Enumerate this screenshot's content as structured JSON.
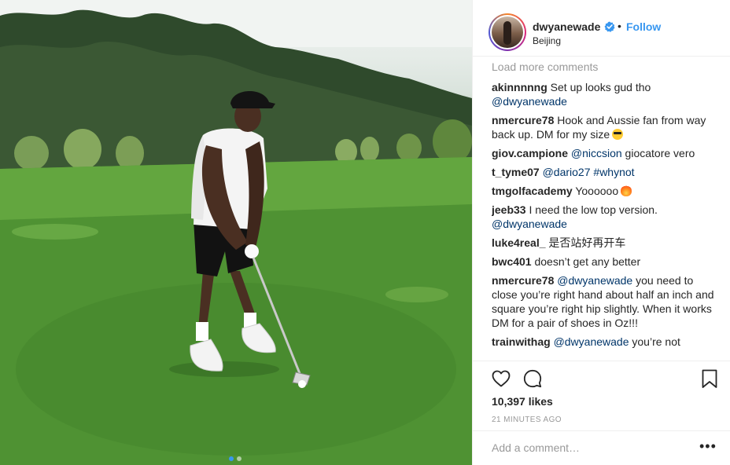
{
  "post": {
    "username": "dwyanewade",
    "bullet": "•",
    "follow_label": "Follow",
    "location": "Beijing",
    "load_more": "Load more comments",
    "likes": "10,397 likes",
    "timestamp": "21 MINUTES AGO",
    "add_comment_placeholder": "Add a comment…",
    "more_label": "•••",
    "carousel_count": 2,
    "carousel_active_index": 0
  },
  "comments": [
    {
      "user": "akinnnnng",
      "parts": [
        {
          "t": "text",
          "v": " Set up looks gud tho "
        },
        {
          "t": "mention",
          "v": "@dwyanewade"
        }
      ]
    },
    {
      "user": "nmercure78",
      "parts": [
        {
          "t": "text",
          "v": " Hook and Aussie fan from way back up. DM for my size"
        },
        {
          "t": "emoji",
          "v": "cool"
        }
      ]
    },
    {
      "user": "giov.campione",
      "parts": [
        {
          "t": "text",
          "v": " "
        },
        {
          "t": "mention",
          "v": "@niccsion"
        },
        {
          "t": "text",
          "v": " giocatore vero"
        }
      ]
    },
    {
      "user": "t_tyme07",
      "parts": [
        {
          "t": "text",
          "v": " "
        },
        {
          "t": "mention",
          "v": "@dario27"
        },
        {
          "t": "text",
          "v": " "
        },
        {
          "t": "mention",
          "v": "#whynot"
        }
      ]
    },
    {
      "user": "tmgolfacademy",
      "parts": [
        {
          "t": "text",
          "v": " Yoooooo"
        },
        {
          "t": "emoji",
          "v": "fire"
        }
      ]
    },
    {
      "user": "jeeb33",
      "parts": [
        {
          "t": "text",
          "v": " I need the low top version. "
        },
        {
          "t": "mention",
          "v": "@dwyanewade"
        }
      ]
    },
    {
      "user": "luke4real_",
      "parts": [
        {
          "t": "text",
          "v": " 是否站好再开车"
        }
      ]
    },
    {
      "user": "bwc401",
      "parts": [
        {
          "t": "text",
          "v": " doesn’t get any better"
        }
      ]
    },
    {
      "user": "nmercure78",
      "parts": [
        {
          "t": "text",
          "v": " "
        },
        {
          "t": "mention",
          "v": "@dwyanewade"
        },
        {
          "t": "text",
          "v": " you need to close you’re right hand about half an inch and square you’re right hip slightly. When it works DM for a pair of shoes in Oz!!!"
        }
      ]
    },
    {
      "user": "trainwithag",
      "parts": [
        {
          "t": "text",
          "v": " "
        },
        {
          "t": "mention",
          "v": "@dwyanewade"
        },
        {
          "t": "text",
          "v": " you’re not"
        }
      ]
    }
  ],
  "colors": {
    "link": "#3897f0",
    "mention": "#003569",
    "muted": "#999999",
    "border": "#efefef"
  },
  "icons": [
    "verified-badge-icon",
    "heart-icon",
    "comment-icon",
    "bookmark-icon",
    "more-options-icon"
  ]
}
